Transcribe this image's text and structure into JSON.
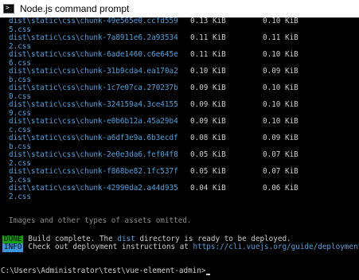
{
  "window": {
    "title": "Node.js command prompt",
    "icon": "terminal-icon",
    "prompt_glyph": ">"
  },
  "assets": [
    {
      "name": "dist\\static\\css\\chunk-49e565e0.ccfd5595.css",
      "size": "0.13 KiB",
      "gzip": "0.10 KiB"
    },
    {
      "name": "dist\\static\\css\\chunk-7a8911e6.2a935342.css",
      "size": "0.11 KiB",
      "gzip": "0.11 KiB"
    },
    {
      "name": "dist\\static\\css\\chunk-6ade1460.c6e645e6.css",
      "size": "0.11 KiB",
      "gzip": "0.10 KiB"
    },
    {
      "name": "dist\\static\\css\\chunk-31b9cda4.ea170a2b.css",
      "size": "0.10 KiB",
      "gzip": "0.09 KiB"
    },
    {
      "name": "dist\\static\\css\\chunk-1c7e07ca.270237b0.css",
      "size": "0.09 KiB",
      "gzip": "0.10 KiB"
    },
    {
      "name": "dist\\static\\css\\chunk-324159a4.3ce41559.css",
      "size": "0.09 KiB",
      "gzip": "0.10 KiB"
    },
    {
      "name": "dist\\static\\css\\chunk-e0b6b12a.45a29b4c.css",
      "size": "0.09 KiB",
      "gzip": "0.10 KiB"
    },
    {
      "name": "dist\\static\\css\\chunk-a6df3e9a.6b3ecdfb.css",
      "size": "0.08 KiB",
      "gzip": "0.09 KiB"
    },
    {
      "name": "dist\\static\\css\\chunk-2e0e3da6.fef04f82.css",
      "size": "0.05 KiB",
      "gzip": "0.07 KiB"
    },
    {
      "name": "dist\\static\\css\\chunk-f868be82.1fc537f3.css",
      "size": "0.05 KiB",
      "gzip": "0.07 KiB"
    },
    {
      "name": "dist\\static\\css\\chunk-42990da2.a44d9352.css",
      "size": "0.04 KiB",
      "gzip": "0.06 KiB"
    }
  ],
  "omitted_note": "Images and other types of assets omitted.",
  "done": {
    "badge": "DONE",
    "text_before": "Build complete. The ",
    "highlight": "dist",
    "text_after": " directory is ready to be deployed."
  },
  "info": {
    "badge": "INFO",
    "text": "Check out deployment instructions at ",
    "link": "https://cli.vuejs.org/guide/deployment."
  },
  "prompt": "C:\\Users\\Administrator\\test\\vue-element-admin>",
  "colors": {
    "background": "#000000",
    "text": "#cccccc",
    "filename": "#4aa3df",
    "muted": "#8c8c8c",
    "done_badge": "#13a10e",
    "info_badge": "#3a96dd"
  }
}
